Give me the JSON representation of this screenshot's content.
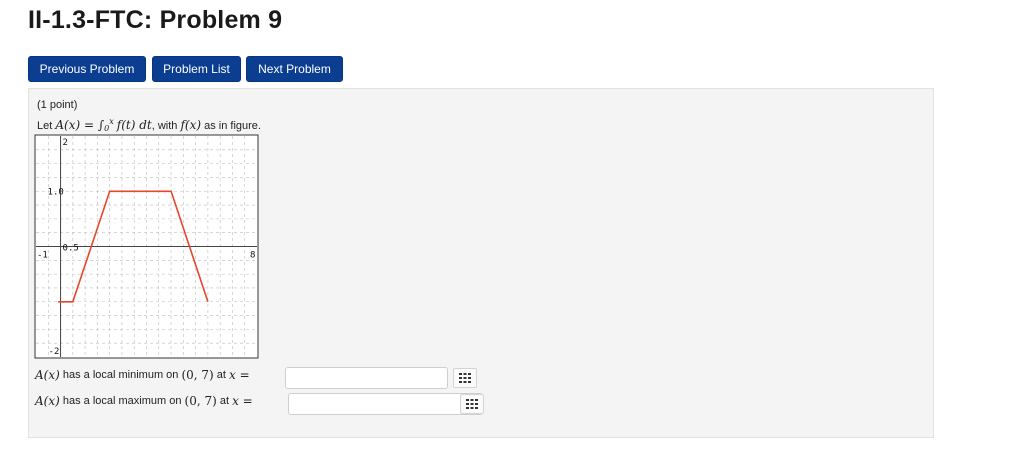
{
  "page": {
    "title": "II-1.3-FTC: Problem 9"
  },
  "nav": {
    "prev": "Previous Problem",
    "list": "Problem List",
    "next": "Next Problem"
  },
  "problem": {
    "points": "(1 point)",
    "prompt_pre": "Let ",
    "prompt_def_lhs": "A(x) = ",
    "integral_lower": "0",
    "integral_upper": "x",
    "integrand": "f(t) dt",
    "prompt_mid": ", with ",
    "prompt_fx": "f(x)",
    "prompt_post": " as in figure.",
    "q1_ax": "A(x)",
    "q1_text": " has a local minimum on ",
    "q1_interval": "(0, 7)",
    "q1_at": " at ",
    "q1_var": "x =",
    "q2_ax": "A(x)",
    "q2_text": " has a local maximum on ",
    "q2_interval": "(0, 7)",
    "q2_at": " at ",
    "q2_var": "x =",
    "answer1_value": "",
    "answer2_value": "",
    "equation_editor_icon": "grid-keypad-icon"
  },
  "chart_data": {
    "type": "line",
    "xlim": [
      -1,
      8
    ],
    "ylim": [
      -2,
      2
    ],
    "grid": true,
    "tick_labels": {
      "x_left": "-1",
      "x_right": "8",
      "y_top": "2",
      "y_bottom": "-2",
      "y_mid_upper": "1.0",
      "y_mid_lower": "0.5"
    },
    "series": [
      {
        "color": "#e8452c",
        "x": [
          -0.1,
          0.5,
          2.0,
          4.5,
          6.0
        ],
        "y": [
          -1.0,
          -1.0,
          1.0,
          1.0,
          -1.0
        ]
      }
    ]
  }
}
